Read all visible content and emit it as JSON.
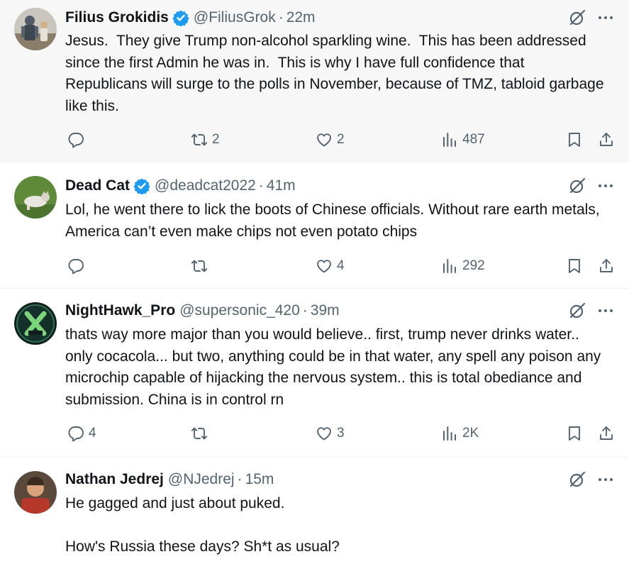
{
  "posts": [
    {
      "name": "Filius Grokidis",
      "handle": "@FiliusGrok",
      "time": "22m",
      "text": "Jesus.  They give Trump non-alcohol sparkling wine.  This has been addressed since the first Admin he was in.  This is why I have full confidence that Republicans will surge to the polls in November, because of TMZ, tabloid garbage like this.",
      "replies": "",
      "reposts": "2",
      "likes": "2",
      "views": "487"
    },
    {
      "name": "Dead Cat",
      "handle": "@deadcat2022",
      "time": "41m",
      "text": "Lol, he went there to lick the boots of Chinese officials. Without rare earth metals, America can’t even make chips not even potato chips",
      "replies": "",
      "reposts": "",
      "likes": "4",
      "views": "292"
    },
    {
      "name": "NightHawk_Pro",
      "handle": "@supersonic_420",
      "time": "39m",
      "text": "thats way more major than you would believe.. first, trump never drinks water.. only cocacola... but two, anything could be in that water, any spell any poison any microchip capable of hijacking the nervous system.. this is total obediance and submission. China is in control rn",
      "replies": "4",
      "reposts": "",
      "likes": "3",
      "views": "2K"
    },
    {
      "name": "Nathan Jedrej",
      "handle": "@NJedrej",
      "time": "15m",
      "text": "He gagged and just about puked.\n\nHow's Russia these days? Sh*t as usual?"
    }
  ],
  "separator": "·",
  "colors": {
    "text": "#0f1419",
    "secondary": "#536471",
    "verified": "#1d9bf0",
    "highlight_bg": "#f7f7f7",
    "divider": "#eff3f4"
  }
}
